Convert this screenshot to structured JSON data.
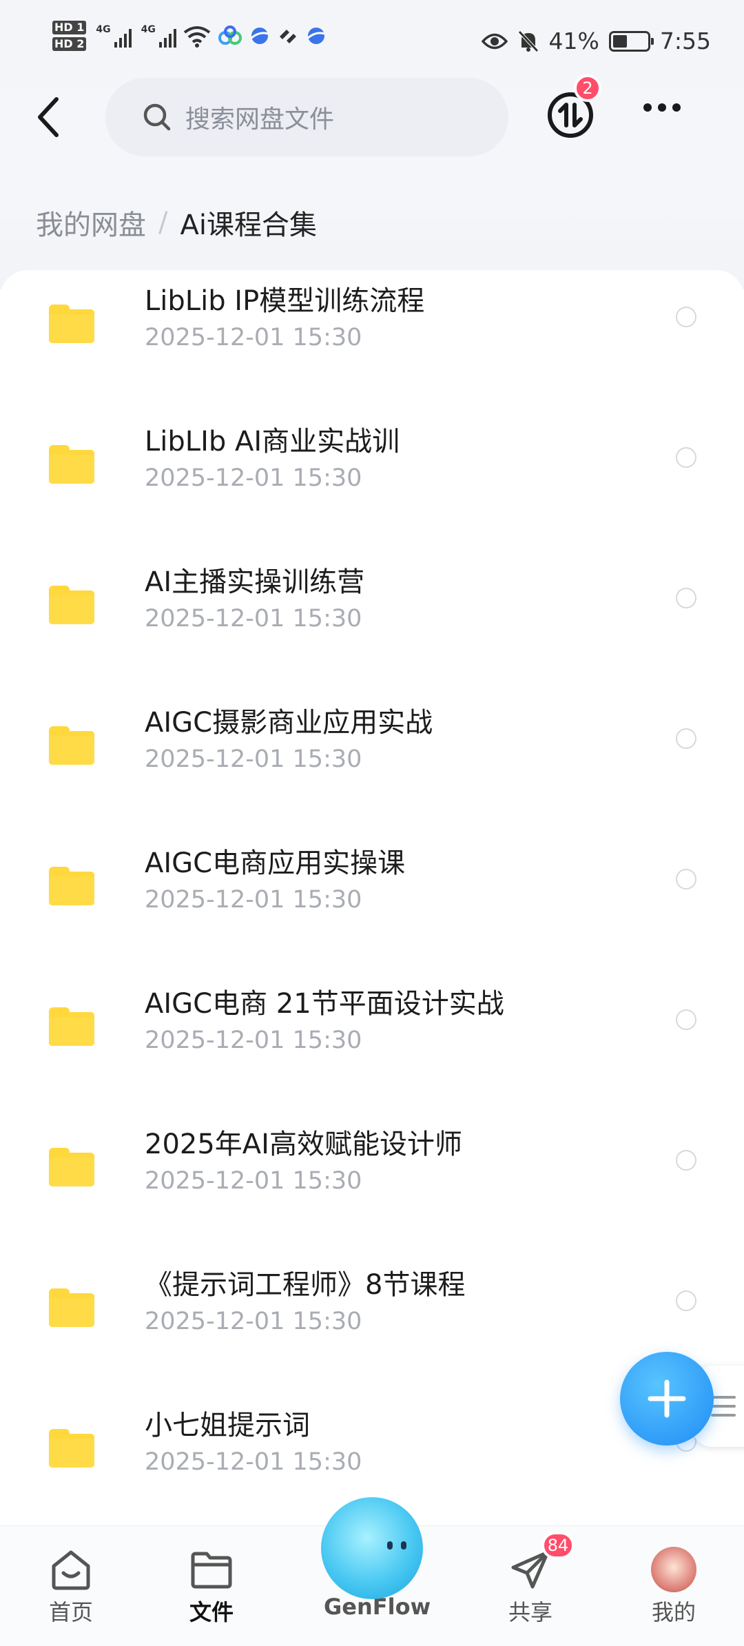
{
  "status_bar": {
    "sim1": "HD 1",
    "sim2": "HD 2",
    "net1": "4G",
    "net2": "4G",
    "battery_percent": "41%",
    "battery_level": 0.41,
    "time": "7:55"
  },
  "top_bar": {
    "search_placeholder": "搜索网盘文件",
    "transfer_badge": "2"
  },
  "breadcrumb": {
    "root": "我的网盘",
    "separator": "/",
    "current": "Ai课程合集"
  },
  "files": [
    {
      "name": "LibLib IP模型训练流程",
      "date": "2025-12-01  15:30"
    },
    {
      "name": "LibLIb AI商业实战训",
      "date": "2025-12-01  15:30"
    },
    {
      "name": "AI主播实操训练营",
      "date": "2025-12-01  15:30"
    },
    {
      "name": "AIGC摄影商业应用实战",
      "date": "2025-12-01  15:30"
    },
    {
      "name": "AIGC电商应用实操课",
      "date": "2025-12-01  15:30"
    },
    {
      "name": "AIGC电商 21节平面设计实战",
      "date": "2025-12-01  15:30"
    },
    {
      "name": "2025年AI高效赋能设计师",
      "date": "2025-12-01  15:30"
    },
    {
      "name": "《提示词工程师》8节课程",
      "date": "2025-12-01  15:30"
    },
    {
      "name": "小七姐提示词",
      "date": "2025-12-01  15:30"
    }
  ],
  "bottom_nav": {
    "home": "首页",
    "files": "文件",
    "genflow": "GenFlow",
    "share": "共享",
    "share_badge": "84",
    "mine": "我的"
  },
  "colors": {
    "accent": "#1f8cf5",
    "badge": "#ff4d6a",
    "folder": "#ffd83d"
  }
}
